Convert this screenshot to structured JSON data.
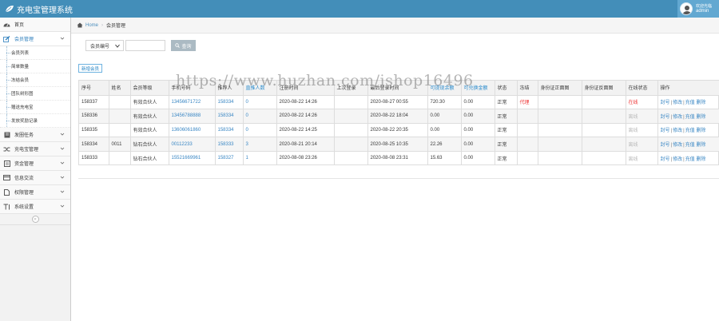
{
  "app": {
    "title": "充电宝管理系统"
  },
  "user": {
    "welcome": "欢迎光临",
    "name": "admin"
  },
  "sidebar": {
    "items": [
      {
        "label": "首页",
        "icon": "tachometer-icon"
      },
      {
        "label": "会员管理",
        "icon": "edit-icon",
        "expanded": true,
        "children": [
          "会员列表",
          "简单数量",
          "冻结会员",
          "团队树形图",
          "赠送充电宝",
          "发放奖励记录"
        ]
      },
      {
        "label": "发圈任务",
        "icon": "book-icon"
      },
      {
        "label": "充电宝管理",
        "icon": "random-icon"
      },
      {
        "label": "资金管理",
        "icon": "list-icon"
      },
      {
        "label": "信息交流",
        "icon": "credit-card-icon"
      },
      {
        "label": "权限管理",
        "icon": "file-icon"
      },
      {
        "label": "系统设置",
        "icon": "text-height-icon"
      }
    ]
  },
  "breadcrumb": {
    "home": "Home",
    "current": "会员管理"
  },
  "search": {
    "select_value": "会员编号",
    "input_value": "",
    "button_label": "查询"
  },
  "toolbar": {
    "add_label": "新增会员"
  },
  "watermark": "https://www.huzhan.com/ishop16496",
  "table": {
    "headers": [
      "序号",
      "姓名",
      "会员等级",
      "手机号码",
      "推荐人",
      "直推人数",
      "注册时间",
      "上次登录",
      "最后登录时间",
      "可提现余额",
      "可兑换金额",
      "状态",
      "冻结",
      "身份证正面图",
      "身份证反面图",
      "在线状态",
      "操作"
    ],
    "rows": [
      [
        "158337",
        "",
        "有效合伙人",
        "13456671722",
        "158334",
        "0",
        "2020-08-22 14:26",
        "",
        "2020-08-27 00:55",
        "720.30",
        "0.00",
        "正常",
        "代理",
        "",
        "",
        "在线",
        "封号 | 修改 | 充值 删除"
      ],
      [
        "158336",
        "",
        "有效合伙人",
        "13456788888",
        "158334",
        "0",
        "2020-08-22 14:26",
        "",
        "2020-08-22 18:04",
        "0.00",
        "0.00",
        "正常",
        "",
        "",
        "",
        "离线",
        "封号 | 修改 | 充值 删除"
      ],
      [
        "158335",
        "",
        "有效合伙人",
        "13606061860",
        "158334",
        "0",
        "2020-08-22 14:25",
        "",
        "2020-08-22 20:35",
        "0.00",
        "0.00",
        "正常",
        "",
        "",
        "",
        "离线",
        "封号 | 修改 | 充值 删除"
      ],
      [
        "158334",
        "0011",
        "钻石合伙人",
        "00112233",
        "158333",
        "3",
        "2020-08-21 20:14",
        "",
        "2020-08-25 10:35",
        "22.26",
        "0.00",
        "正常",
        "",
        "",
        "",
        "离线",
        "封号 | 修改 | 充值 删除"
      ],
      [
        "158333",
        "",
        "钻石合伙人",
        "15521669961",
        "158327",
        "1",
        "2020-08-08 23:26",
        "",
        "2020-08-08 23:31",
        "15.63",
        "0.00",
        "正常",
        "",
        "",
        "",
        "离线",
        "封号 | 修改 | 充值 删除"
      ]
    ]
  },
  "colors": {
    "navbar": "#438eb9",
    "user_box": "#62a8d1",
    "link": "#3a87c4",
    "online": "#e33333"
  }
}
